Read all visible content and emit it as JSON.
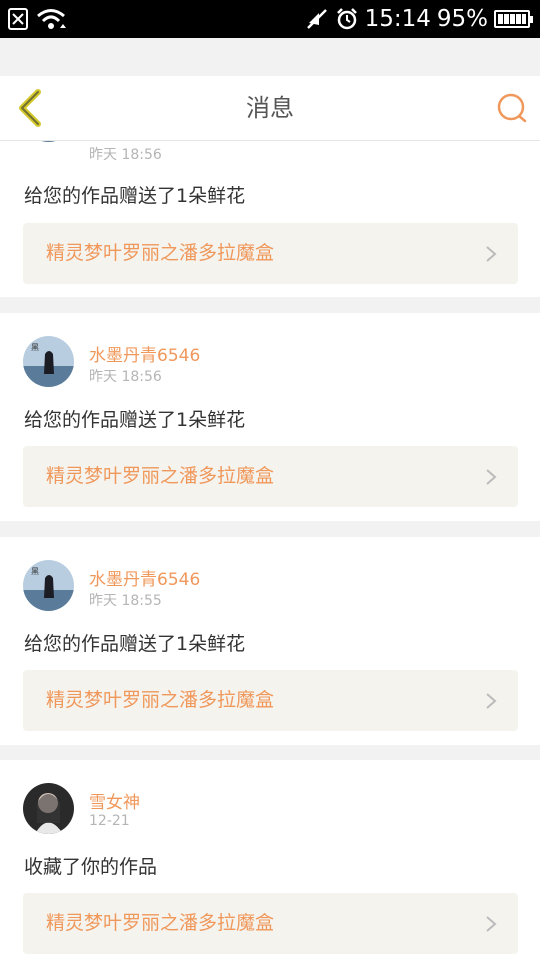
{
  "status_bar": {
    "time": "15:14",
    "battery": "95%",
    "icons": [
      "sim-icon",
      "wifi-icon",
      "mute-icon",
      "alarm-icon",
      "battery-icon"
    ]
  },
  "header": {
    "title": "消息",
    "accent": "#f0985b",
    "back_icon_color": "#d4c92a"
  },
  "messages": [
    {
      "username": "",
      "time": "昨天 18:56",
      "action": "给您的作品赠送了1朵鲜花",
      "work": "精灵梦叶罗丽之潘多拉魔盒"
    },
    {
      "username": "水墨丹青6546",
      "time": "昨天 18:56",
      "action": "给您的作品赠送了1朵鲜花",
      "work": "精灵梦叶罗丽之潘多拉魔盒"
    },
    {
      "username": "水墨丹青6546",
      "time": "昨天 18:55",
      "action": "给您的作品赠送了1朵鲜花",
      "work": "精灵梦叶罗丽之潘多拉魔盒"
    },
    {
      "username": "雪女神",
      "time": "12-21",
      "action": "收藏了你的作品",
      "work": "精灵梦叶罗丽之潘多拉魔盒"
    }
  ]
}
